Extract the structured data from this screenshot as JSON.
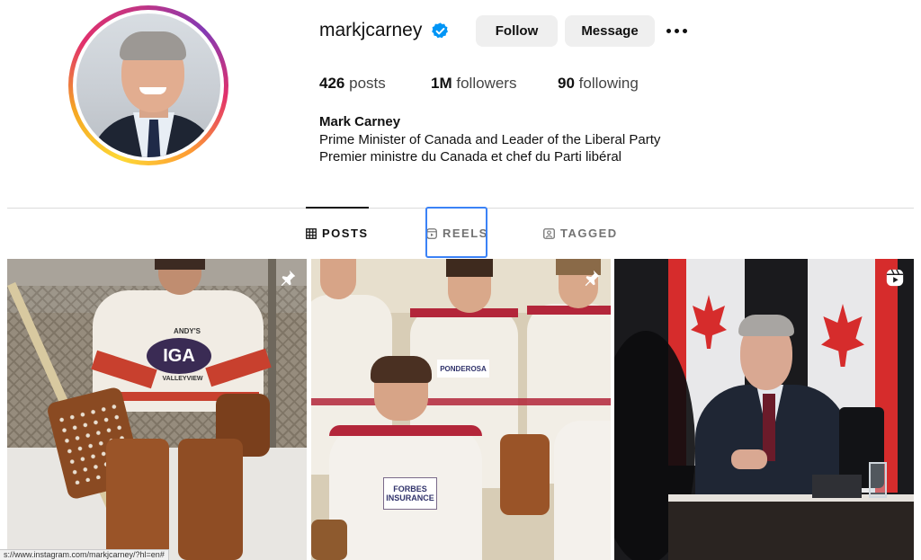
{
  "profile": {
    "username": "markjcarney",
    "verified": true,
    "follow_label": "Follow",
    "message_label": "Message",
    "more_icon": "more-horizontal-icon"
  },
  "stats": {
    "posts_count": "426",
    "posts_label": "posts",
    "followers_count": "1M",
    "followers_label": "followers",
    "following_count": "90",
    "following_label": "following"
  },
  "bio": {
    "name": "Mark Carney",
    "line1": "Prime Minister of Canada and Leader of the Liberal Party",
    "line2": "Premier ministre du Canada et chef du Parti libéral"
  },
  "tabs": [
    {
      "label": "POSTS",
      "icon": "grid-icon",
      "active": true
    },
    {
      "label": "REELS",
      "icon": "reels-icon",
      "active": false
    },
    {
      "label": "TAGGED",
      "icon": "tagged-icon",
      "active": false
    }
  ],
  "posts": [
    {
      "description_icon": "pin-icon",
      "jersey_text": "IGA",
      "jersey_top": "ANDY'S",
      "jersey_bottom": "VALLEYVIEW"
    },
    {
      "description_icon": "pin-icon",
      "jersey_text": "PONDEROSA",
      "jersey_front": "FORBES INSURANCE"
    },
    {
      "description_icon": "reel-icon"
    }
  ],
  "status_url": "s://www.instagram.com/markjcarney/?hl=en#",
  "colors": {
    "accent_blue": "#3b82f6",
    "verified_blue": "#0095f6",
    "button_bg": "#efefef"
  }
}
